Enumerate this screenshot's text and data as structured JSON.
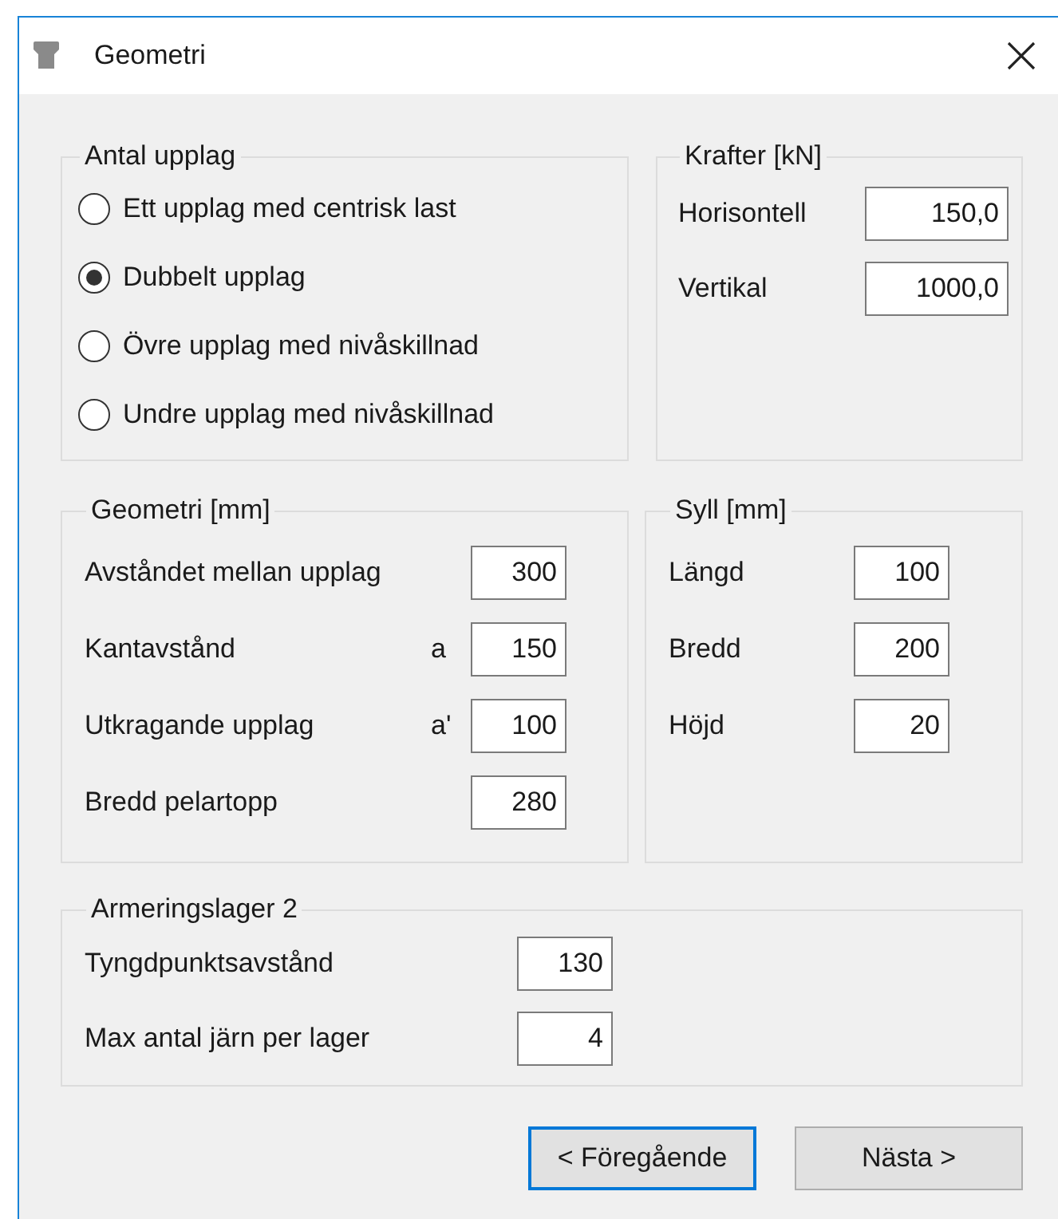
{
  "window": {
    "title": "Geometri"
  },
  "antal_upplag": {
    "title": "Antal upplag",
    "options": [
      {
        "label": "Ett upplag med centrisk last",
        "selected": false
      },
      {
        "label": "Dubbelt upplag",
        "selected": true
      },
      {
        "label": "Övre upplag med nivåskillnad",
        "selected": false
      },
      {
        "label": "Undre upplag med nivåskillnad",
        "selected": false
      }
    ]
  },
  "krafter": {
    "title": "Krafter [kN]",
    "fields": [
      {
        "label": "Horisontell",
        "value": "150,0"
      },
      {
        "label": "Vertikal",
        "value": "1000,0"
      }
    ]
  },
  "geometri": {
    "title": "Geometri [mm]",
    "fields": [
      {
        "label": "Avståndet mellan upplag",
        "value": "300"
      },
      {
        "label": "Kantavstånd",
        "symbol": "a",
        "value": "150"
      },
      {
        "label": "Utkragande upplag",
        "symbol": "a'",
        "value": "100"
      },
      {
        "label": "Bredd pelartopp",
        "value": "280"
      }
    ]
  },
  "syll": {
    "title": "Syll [mm]",
    "fields": [
      {
        "label": "Längd",
        "value": "100"
      },
      {
        "label": "Bredd",
        "value": "200"
      },
      {
        "label": "Höjd",
        "value": "20"
      }
    ]
  },
  "armeringslager": {
    "title": "Armeringslager 2",
    "fields": [
      {
        "label": "Tyngdpunktsavstånd",
        "value": "130"
      },
      {
        "label": "Max antal järn per lager",
        "value": "4"
      }
    ]
  },
  "buttons": [
    {
      "label": "< Föregående",
      "focused": true
    },
    {
      "label": "Nästa >",
      "focused": false
    }
  ]
}
